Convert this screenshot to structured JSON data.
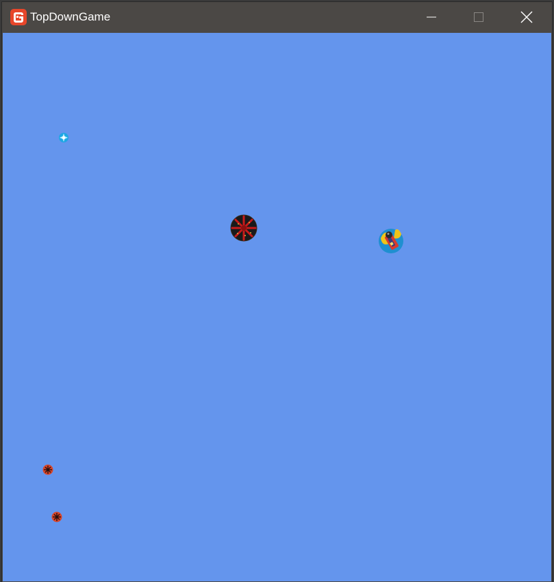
{
  "window": {
    "title": "TopDownGame",
    "icon": "monogame-logo-icon",
    "buttons": [
      "minimize-icon",
      "maximize-icon",
      "close-icon"
    ]
  },
  "viewport": {
    "background": "#6495ED"
  },
  "sprites": [
    {
      "kind": "player-ship",
      "icon": "spaceship-icon"
    },
    {
      "kind": "large-red-spiked-enemy",
      "icon": "spiked-mine-icon"
    },
    {
      "kind": "small-cyan-crystal-pickup",
      "icon": "crystal-icon"
    },
    {
      "kind": "small-red-enemy",
      "icon": "small-mine-icon"
    },
    {
      "kind": "small-red-enemy",
      "icon": "small-mine-icon"
    }
  ]
}
